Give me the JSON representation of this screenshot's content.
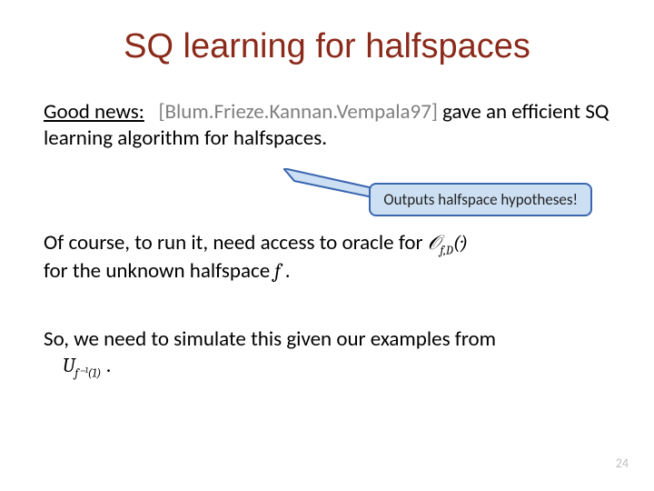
{
  "title": "SQ learning for halfspaces",
  "para1": {
    "good_news": "Good news:",
    "citation": "[Blum.Frieze.Kannan.Vempala97]",
    "tail": " gave an efficient SQ learning algorithm for halfspaces."
  },
  "callout": "Outputs  halfspace hypotheses!",
  "para2": {
    "lead": "Of course, to run it, need access to oracle for  ",
    "oracle": "𝒪",
    "oracle_sub": "f,D",
    "oracle_arg": "(·)",
    "line2a": "for the unknown halfspace  ",
    "f": "f",
    "period": " ."
  },
  "para3": {
    "text": "So, we need to simulate this given our examples from",
    "U": "U",
    "Usub": "f⁻¹(1)",
    "period": " ."
  },
  "page_number": "24"
}
